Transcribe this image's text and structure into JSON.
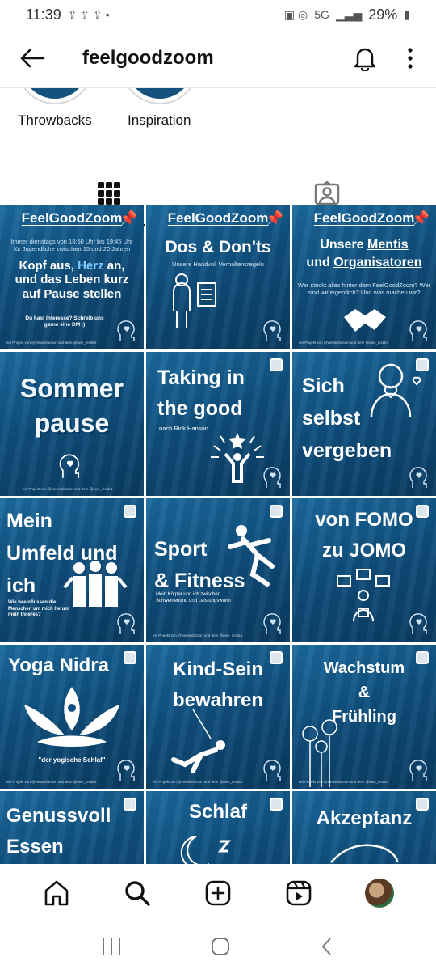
{
  "status": {
    "time": "11:39",
    "battery": "29%",
    "network": "5G"
  },
  "header": {
    "title": "feelgoodzoom"
  },
  "highlights": [
    {
      "label": "Throwbacks"
    },
    {
      "label": "Inspiration"
    }
  ],
  "posts": {
    "p1": {
      "brand": "FeelGoodZoom",
      "info": "Immer dienstags von 18:50 Uhr bis 19:45 Uhr für Jugendliche zwischen 15 und 20 Jahren",
      "t1": "Kopf aus,",
      "t2": "Herz",
      "t3": "an,",
      "t4": "und das Leben kurz",
      "t5": "auf",
      "t6": "Pause stellen",
      "cta": "Du hast Interesse? Schreib uns gerne eine DM :)",
      "foot": "ein Projekt von @wewesfaction und dem @ewe_institut"
    },
    "p2": {
      "brand": "FeelGoodZoom",
      "title": "Dos & Don'ts",
      "sub": "Unsere Handvoll Verhaltensregeln"
    },
    "p3": {
      "brand": "FeelGoodZoom",
      "title1": "Unsere",
      "title2": "Mentis",
      "title3": "und",
      "title4": "Organisatoren",
      "sub": "Wer steckt alles hinter dem FeelGoodZoom? Wer sind wir eigentlich? Und was machen wir?",
      "foot": "ein Projekt von @wewesfaction und dem @ewe_institut"
    },
    "p4": {
      "title1": "Sommer",
      "title2": "pause",
      "foot": "ein Projekt von @wewesfaction und dem @ewe_institut"
    },
    "p5": {
      "title1": "Taking in",
      "title2": "the good",
      "sub": "nach Rick Hanson"
    },
    "p6": {
      "title1": "Sich",
      "title2": "selbst",
      "title3": "vergeben"
    },
    "p7": {
      "title1": "Mein",
      "title2": "Umfeld und",
      "title3": "ich",
      "sub": "Wie beeinflussen die Menschen um mich herum mein Inneres?"
    },
    "p8": {
      "title1": "Sport",
      "title2": "& Fitness",
      "sub": "Mein Körper und ich zwischen Schweinehund und Leistungswahn",
      "foot": "ein Projekt von @wewesfaction und dem @ewe_institut"
    },
    "p9": {
      "title1": "von FOMO",
      "title2": "zu JOMO"
    },
    "p10": {
      "title": "Yoga Nidra",
      "sub": "\"der yogische Schlaf\"",
      "foot": "ein Projekt von @wewesfaction und dem @ewe_institut"
    },
    "p11": {
      "title1": "Kind-Sein",
      "title2": "bewahren",
      "foot": "ein Projekt von @wewesfaction und dem @ewe_institut"
    },
    "p12": {
      "title1": "Wachstum",
      "title2": "&",
      "title3": "Frühling",
      "foot": "ein Projekt von @wewesfaction und dem @ewe_institut"
    },
    "p13": {
      "title1": "Genussvoll",
      "title2": "Essen"
    },
    "p14": {
      "title": "Schlaf"
    },
    "p15": {
      "title": "Akzeptanz"
    }
  },
  "icons": {
    "back": "arrow-left-icon",
    "bell": "bell-icon",
    "more": "more-vertical-icon",
    "grid": "grid-icon",
    "tagged": "tagged-icon",
    "home": "home-icon",
    "search": "search-icon",
    "add": "add-icon",
    "reels": "reels-icon"
  }
}
